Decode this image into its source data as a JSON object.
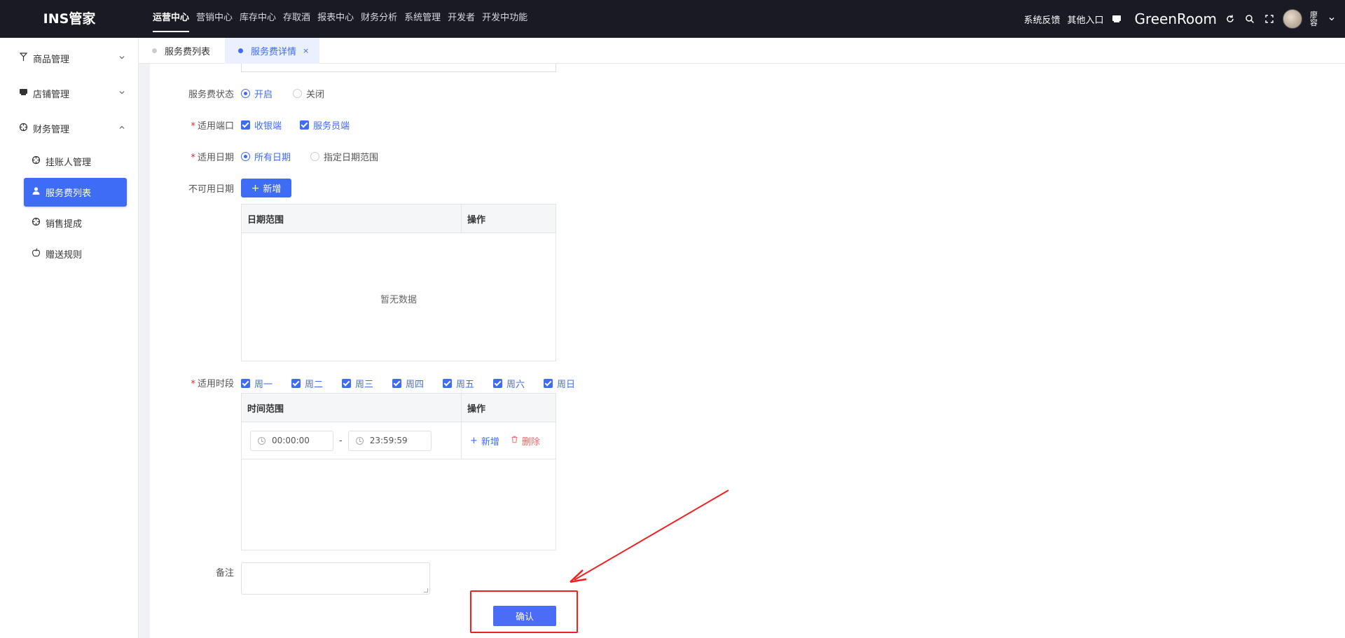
{
  "app": {
    "logo": "INS管家"
  },
  "topnav": [
    {
      "label": "运营中心",
      "active": true
    },
    {
      "label": "营销中心"
    },
    {
      "label": "库存中心"
    },
    {
      "label": "存取酒"
    },
    {
      "label": "报表中心"
    },
    {
      "label": "财务分析"
    },
    {
      "label": "系统管理"
    },
    {
      "label": "开发者"
    },
    {
      "label": "开发中功能"
    }
  ],
  "topright": {
    "feedback": "系统反馈",
    "other_entry": "其他入口",
    "store_name": "GreenRoom",
    "user_name": "廖容"
  },
  "sidebar": {
    "groups": [
      {
        "label": "商品管理",
        "icon": "goods-icon",
        "expanded": false
      },
      {
        "label": "店铺管理",
        "icon": "store-icon",
        "expanded": false
      },
      {
        "label": "财务管理",
        "icon": "finance-icon",
        "expanded": true,
        "items": [
          {
            "label": "挂账人管理",
            "icon": "finance-icon"
          },
          {
            "label": "服务费列表",
            "icon": "user-icon",
            "active": true
          },
          {
            "label": "销售提成",
            "icon": "finance-icon"
          },
          {
            "label": "赠送规则",
            "icon": "apple-icon"
          }
        ]
      }
    ]
  },
  "tabs": [
    {
      "label": "服务费列表",
      "active": false
    },
    {
      "label": "服务费详情",
      "active": true,
      "close": "×"
    }
  ],
  "form": {
    "status": {
      "label": "服务费状态",
      "options": [
        "开启",
        "关闭"
      ],
      "selected": "开启"
    },
    "terminals": {
      "label": "适用端口",
      "required": "*",
      "options": [
        "收银端",
        "服务员端"
      ],
      "checked": [
        "收银端",
        "服务员端"
      ]
    },
    "dates": {
      "label": "适用日期",
      "required": "*",
      "options": [
        "所有日期",
        "指定日期范围"
      ],
      "selected": "所有日期"
    },
    "unavailable": {
      "label": "不可用日期",
      "add_button": "新增",
      "columns": [
        "日期范围",
        "操作"
      ],
      "empty_text": "暂无数据"
    },
    "periods": {
      "label": "适用时段",
      "required": "*",
      "weekdays": [
        "周一",
        "周二",
        "周三",
        "周四",
        "周五",
        "周六",
        "周日"
      ],
      "columns": [
        "时间范围",
        "操作"
      ],
      "rows": [
        {
          "start": "00:00:00",
          "sep": "-",
          "end": "23:59:59",
          "add": "新增",
          "delete": "删除"
        }
      ]
    },
    "remark": {
      "label": "备注",
      "value": ""
    },
    "confirm_button": "确认"
  },
  "annotation_color": "#f02020",
  "accent": "#3f6cf5"
}
